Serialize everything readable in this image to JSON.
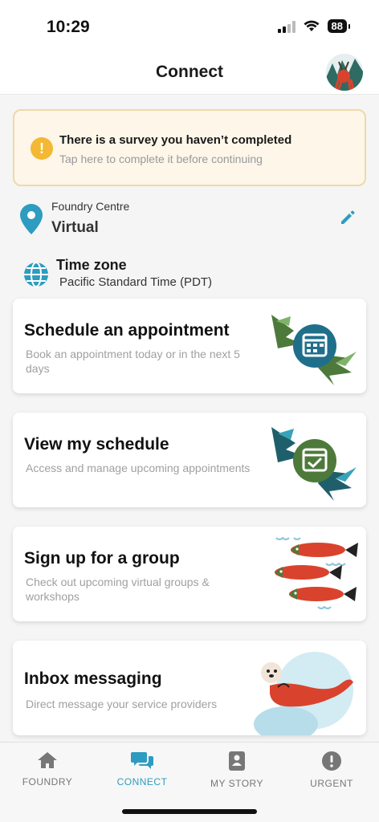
{
  "status_bar": {
    "time": "10:29",
    "battery": "88"
  },
  "header": {
    "title": "Connect",
    "avatar_icon": "profile-avatar-icon"
  },
  "survey": {
    "title": "There is a survey you haven’t completed",
    "subtitle": "Tap here to complete it before continuing",
    "icon": "alert-icon"
  },
  "location": {
    "label": "Foundry Centre",
    "value": "Virtual",
    "icon": "location-pin-icon",
    "edit_icon": "pencil-icon"
  },
  "timezone": {
    "label": "Time zone",
    "value": "Pacific Standard Time (PDT)",
    "icon": "globe-icon"
  },
  "cards": [
    {
      "title": "Schedule an appointment",
      "subtitle": "Book an appointment today or in the next 5 days",
      "icon": "calendar-icon"
    },
    {
      "title": "View my schedule",
      "subtitle": "Access and manage upcoming appointments",
      "icon": "calendar-check-icon"
    },
    {
      "title": "Sign up for a group",
      "subtitle": "Check out upcoming virtual groups & workshops",
      "icon": "salmon-icon"
    },
    {
      "title": "Inbox messaging",
      "subtitle": "Direct message your service providers",
      "icon": "otter-icon"
    }
  ],
  "nav": [
    {
      "label": "FOUNDRY",
      "icon": "home-icon",
      "active": false
    },
    {
      "label": "CONNECT",
      "icon": "chat-icon",
      "active": true
    },
    {
      "label": "MY STORY",
      "icon": "book-icon",
      "active": false
    },
    {
      "label": "URGENT",
      "icon": "alert-icon",
      "active": false
    }
  ],
  "colors": {
    "accent": "#2d9cc0",
    "survey_bg": "#fdf6e9",
    "survey_border": "#f0d8a8",
    "warning": "#f3b834",
    "salmon": "#d9432d"
  }
}
